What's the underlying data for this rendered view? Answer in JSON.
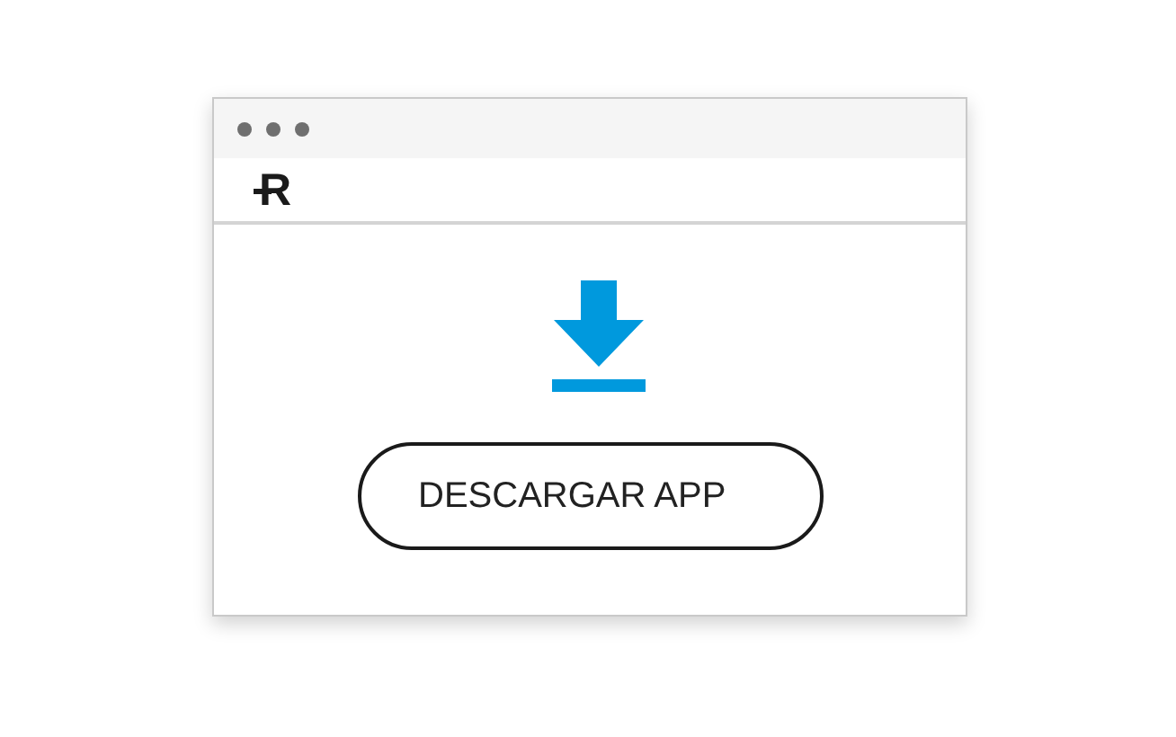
{
  "header": {
    "logo": "R"
  },
  "download": {
    "button": "DESCARGAR APP"
  }
}
